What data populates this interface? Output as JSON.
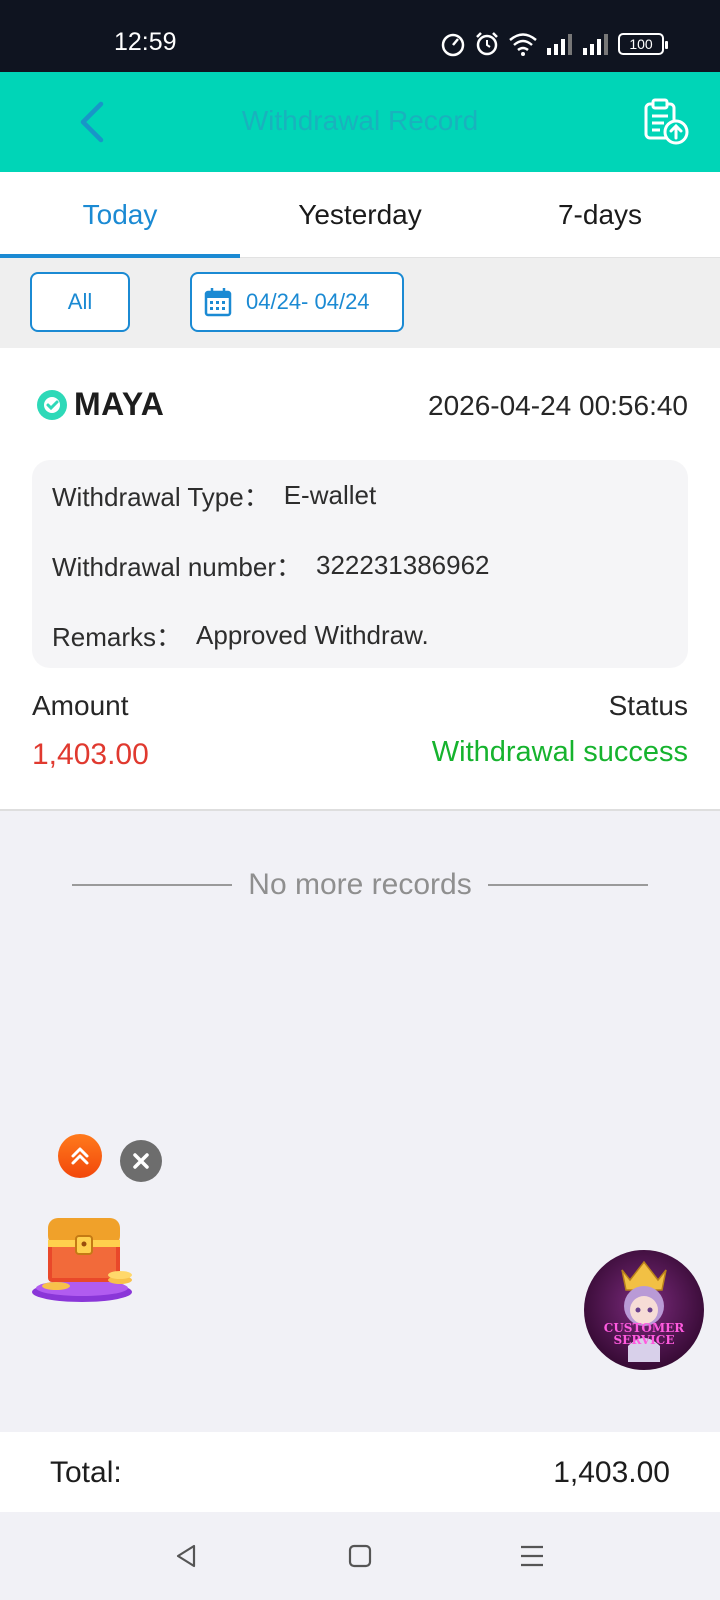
{
  "status_bar": {
    "time": "12:59",
    "battery": "100",
    "icons": [
      "speed-icon",
      "alarm-icon",
      "wifi-icon",
      "signal-icon",
      "signal-icon",
      "battery-icon"
    ]
  },
  "header": {
    "title": "Withdrawal Record",
    "back_icon": "chevron-left-icon",
    "action_icon": "clipboard-upload-icon"
  },
  "tabs": [
    {
      "label": "Today",
      "active": true
    },
    {
      "label": "Yesterday",
      "active": false
    },
    {
      "label": "7-days",
      "active": false
    }
  ],
  "filters": {
    "type_label": "All",
    "date_range": "04/24- 04/24",
    "date_icon": "calendar-icon"
  },
  "record": {
    "provider": "MAYA",
    "datetime": "2026-04-24 00:56:40",
    "details": [
      {
        "label": "Withdrawal Type：",
        "value": "E-wallet"
      },
      {
        "label": "Withdrawal number：",
        "value": "322231386962"
      },
      {
        "label": "Remarks：",
        "value": "Approved Withdraw."
      }
    ],
    "amount_label": "Amount",
    "amount": "1,403.00",
    "status_label": "Status",
    "status": "Withdrawal success"
  },
  "no_more_text": "No more records",
  "floating": {
    "customer_service_line1": "CUSTOMER",
    "customer_service_line2": "SERVICE"
  },
  "total": {
    "label": "Total:",
    "value": "1,403.00"
  },
  "colors": {
    "header_bg": "#00d5b7",
    "accent_blue": "#1b8ad3",
    "amount_red": "#e0392f",
    "success_green": "#16b32e"
  }
}
